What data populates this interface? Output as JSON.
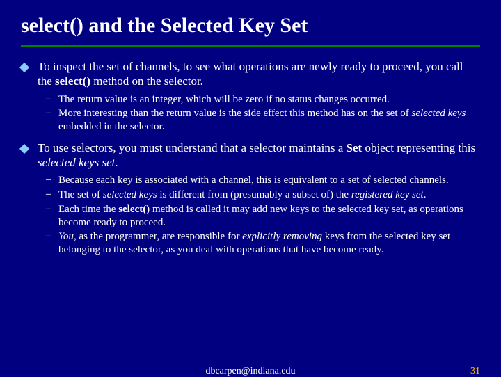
{
  "title": "select() and the Selected Key Set",
  "bullet1_pre": "To inspect the set of channels, to see what operations are newly ready to proceed, you call the ",
  "bullet1_bold": "select()",
  "bullet1_post": " method on the selector.",
  "sub1a": "The return value is an integer, which will be zero if no status changes occurred.",
  "sub1b_pre": "More interesting than the return value is the side effect this method has on the set of ",
  "sub1b_ital": "selected keys",
  "sub1b_post": " embedded in the selector.",
  "bullet2_pre": "To use selectors, you must understand that a selector maintains a ",
  "bullet2_bold": "Set",
  "bullet2_mid": " object representing this ",
  "bullet2_ital": "selected keys set",
  "bullet2_post": ".",
  "sub2a": "Because each key is associated with a channel, this is equivalent to a set of selected channels.",
  "sub2b_pre": "The set of ",
  "sub2b_ital1": "selected keys",
  "sub2b_mid": " is different from (presumably a subset of) the ",
  "sub2b_ital2": "registered key set",
  "sub2b_post": ".",
  "sub2c_pre": "Each time the ",
  "sub2c_bold": "select()",
  "sub2c_post": " method is called it may add new keys to the selected key set, as operations become ready to proceed.",
  "sub2d_ital1": "You",
  "sub2d_mid1": ", as the programmer, are responsible for ",
  "sub2d_ital2": "explicitly removing",
  "sub2d_post": " keys from the selected key set belonging to the selector, as you deal with operations that have become ready.",
  "footer_email": "dbcarpen@indiana.edu",
  "footer_page": "31"
}
